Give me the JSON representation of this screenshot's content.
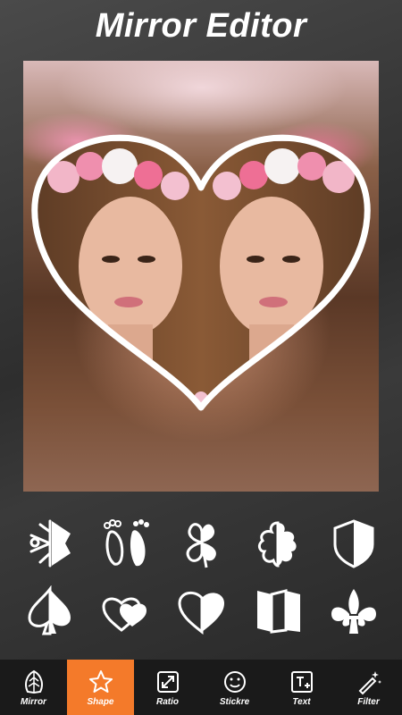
{
  "app": {
    "title": "Mirror Editor"
  },
  "shapes": [
    {
      "icon": "snowflake-half-icon"
    },
    {
      "icon": "footprints-icon"
    },
    {
      "icon": "clover-icon"
    },
    {
      "icon": "flower-half-icon"
    },
    {
      "icon": "shield-icon"
    },
    {
      "icon": "spade-icon"
    },
    {
      "icon": "double-heart-icon"
    },
    {
      "icon": "heart-half-icon"
    },
    {
      "icon": "folded-panel-icon"
    },
    {
      "icon": "fleur-de-lis-icon"
    }
  ],
  "toolbar": {
    "items": [
      {
        "label": "Mirror",
        "icon": "mirror-leaf-icon"
      },
      {
        "label": "Shape",
        "icon": "star-icon",
        "active": true
      },
      {
        "label": "Ratio",
        "icon": "resize-arrows-icon"
      },
      {
        "label": "Stickre",
        "icon": "emoji-icon"
      },
      {
        "label": "Text",
        "icon": "text-plus-icon"
      },
      {
        "label": "Filter",
        "icon": "magic-wand-icon"
      }
    ]
  },
  "colors": {
    "accent": "#f47a2a",
    "toolbar_bg": "#1a1a1a",
    "frame": "#ffffff"
  }
}
